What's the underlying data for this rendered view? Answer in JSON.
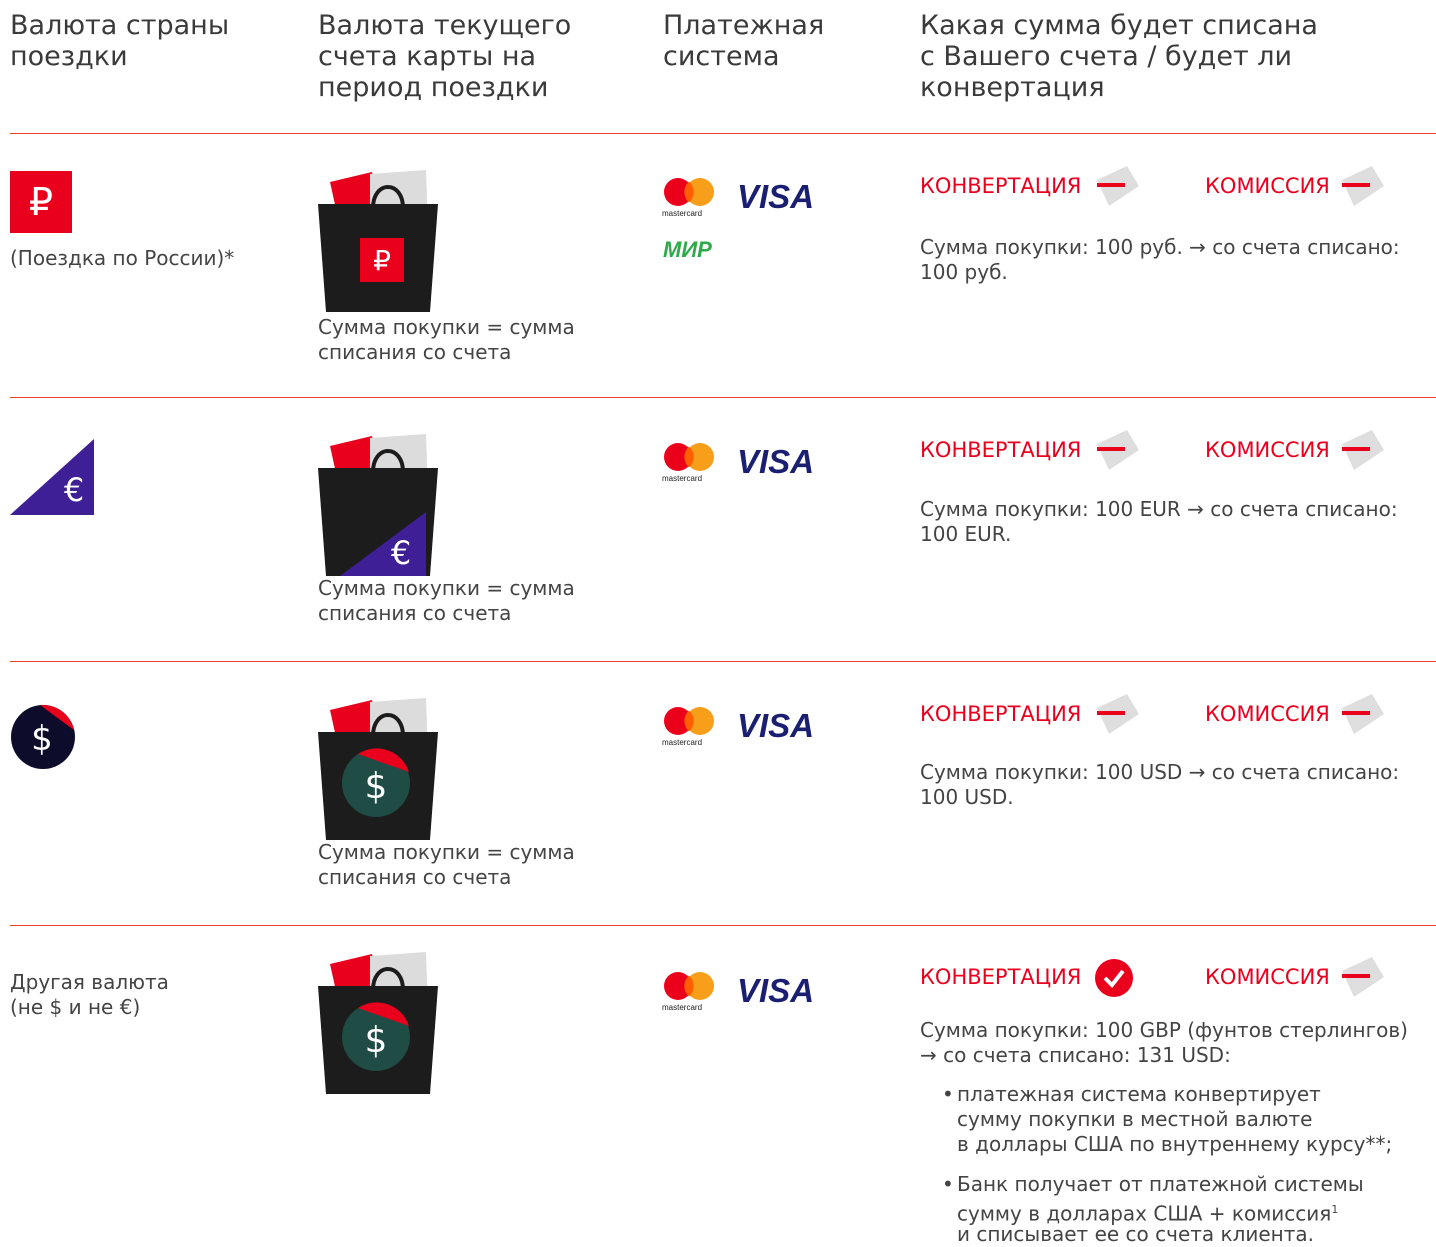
{
  "header": {
    "col1": "Валюта страны\nпоездки",
    "col2": "Валюта текущего\nсчета карты на\nпериод поездки",
    "col3": "Платежная\nсистема",
    "col4": "Какая сумма будет списана\nс Вашего счета / будет ли\nконвертация"
  },
  "labels": {
    "conversion": "КОНВЕРТАЦИЯ",
    "commission": "КОМИССИЯ",
    "same_amount": "Сумма покупки = сумма\nсписания со счета"
  },
  "logos": {
    "visa": "VISA",
    "mastercard": "mastercard",
    "mir": "МИР"
  },
  "rows": [
    {
      "country_text": "(Поездка по России)*",
      "desc": "Сумма покупки: 100 руб. → со счета списано:\n100 руб."
    },
    {
      "country_text": "",
      "desc": "Сумма покупки: 100 EUR → со счета списано:\n100 EUR."
    },
    {
      "country_text": "",
      "desc": "Сумма покупки: 100 USD → со счета списано:\n100 USD."
    },
    {
      "country_text": "Другая валюта\n(не $ и не €)",
      "desc": "Сумма покупки: 100 GBP (фунтов стерлингов)\n→ со счета списано: 131 USD:",
      "bullets": [
        "платежная система конвертирует\nсумму покупки в местной валюте\nв доллары США по внутреннему курсу**;",
        "Банк получает от платежной системы\nсумму в долларах США + комиссия",
        "и списывает ее со счета клиента."
      ],
      "footnote_mark": "1"
    }
  ],
  "colors": {
    "accent": "#e8001c",
    "euro": "#3e1f96",
    "dollar_dark": "#0d0d2b",
    "dollar_green": "#1f4d46"
  }
}
